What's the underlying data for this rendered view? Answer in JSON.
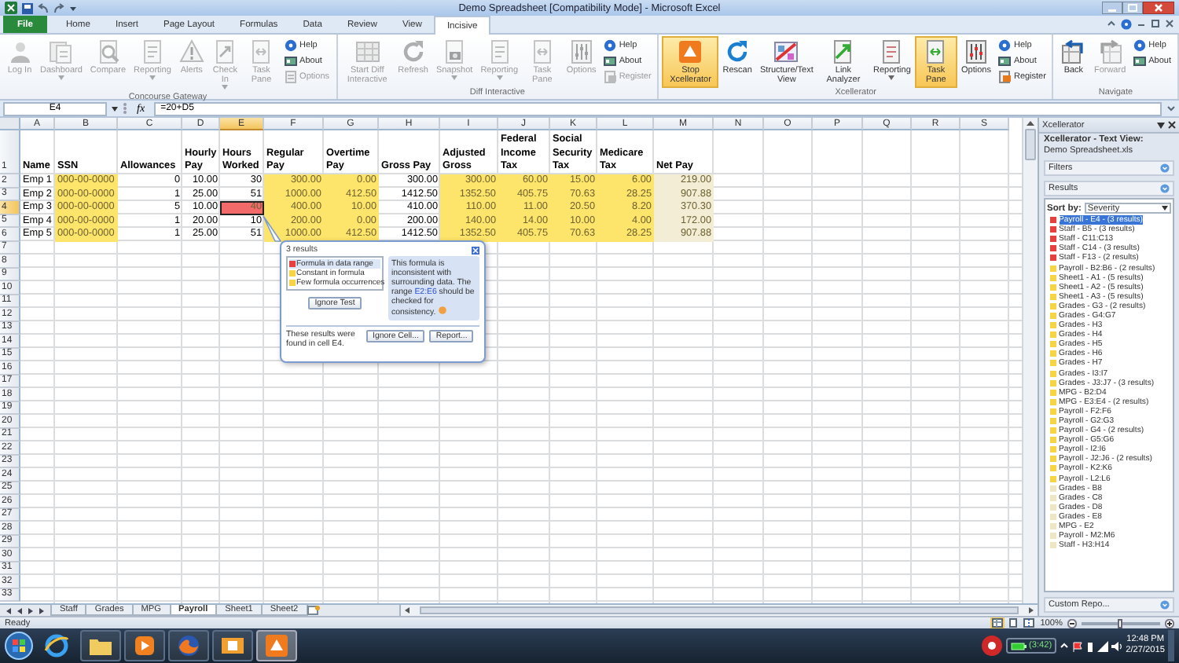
{
  "window": {
    "title": "Demo Spreadsheet  [Compatibility Mode] - Microsoft Excel"
  },
  "ribbon_tabs": [
    {
      "label": "File",
      "kind": "file",
      "selected": false
    },
    {
      "label": "Home",
      "kind": "plain",
      "selected": false
    },
    {
      "label": "Insert",
      "kind": "plain",
      "selected": false
    },
    {
      "label": "Page Layout",
      "kind": "plain",
      "selected": false
    },
    {
      "label": "Formulas",
      "kind": "plain",
      "selected": false
    },
    {
      "label": "Data",
      "kind": "plain",
      "selected": false
    },
    {
      "label": "Review",
      "kind": "plain",
      "selected": false
    },
    {
      "label": "View",
      "kind": "plain",
      "selected": false
    },
    {
      "label": "Incisive",
      "kind": "plain",
      "selected": true
    }
  ],
  "ribbon_groups": [
    {
      "name": "Concourse Gateway",
      "buttons": [
        {
          "label": "Log In",
          "kind": "person",
          "disabled": true,
          "selected": false
        },
        {
          "label": "Dashboard",
          "kind": "dashboard",
          "disabled": true,
          "selected": false,
          "has_menu": true
        },
        {
          "label": "Compare",
          "kind": "compare",
          "disabled": true,
          "selected": false
        },
        {
          "label": "Reporting",
          "kind": "report",
          "disabled": true,
          "selected": false,
          "has_menu": true
        },
        {
          "label": "Alerts",
          "kind": "warning",
          "disabled": true,
          "selected": false
        },
        {
          "label": "Check In",
          "kind": "checkin",
          "disabled": true,
          "selected": false,
          "has_menu": true
        },
        {
          "label": "Task Pane",
          "kind": "taskpane",
          "disabled": true,
          "selected": false
        }
      ],
      "small_buttons": [
        {
          "label": "Help",
          "kind": "help",
          "disabled": false
        },
        {
          "label": "About",
          "kind": "about",
          "disabled": false
        },
        {
          "label": "Options",
          "kind": "options",
          "disabled": true
        }
      ]
    },
    {
      "name": "Diff Interactive",
      "buttons": [
        {
          "label": "Start Diff Interactive",
          "kind": "grid",
          "disabled": true,
          "selected": false
        },
        {
          "label": "Refresh",
          "kind": "refresh",
          "disabled": true,
          "selected": false
        },
        {
          "label": "Snapshot",
          "kind": "camera",
          "disabled": true,
          "selected": false,
          "has_menu": true
        },
        {
          "label": "Reporting",
          "kind": "report",
          "disabled": true,
          "selected": false,
          "has_menu": true
        },
        {
          "label": "Task Pane",
          "kind": "taskpane",
          "disabled": true,
          "selected": false
        },
        {
          "label": "Options",
          "kind": "sliders",
          "disabled": true,
          "selected": false
        }
      ],
      "small_buttons": [
        {
          "label": "Help",
          "kind": "help",
          "disabled": false
        },
        {
          "label": "About",
          "kind": "about",
          "disabled": false
        },
        {
          "label": "Register",
          "kind": "register",
          "disabled": true
        }
      ]
    },
    {
      "name": "Xcellerator",
      "buttons": [
        {
          "label": "Stop Xcellerator",
          "kind": "logo",
          "disabled": false,
          "selected": true
        },
        {
          "label": "Rescan",
          "kind": "refresh",
          "disabled": false,
          "selected": false
        },
        {
          "label": "Structure/Text View",
          "kind": "structure",
          "disabled": false,
          "selected": false
        },
        {
          "label": "Link Analyzer",
          "kind": "link",
          "disabled": false,
          "selected": false
        },
        {
          "label": "Reporting",
          "kind": "report",
          "disabled": false,
          "selected": false,
          "has_menu": true
        },
        {
          "label": "Task Pane",
          "kind": "taskpane",
          "disabled": false,
          "selected": true
        },
        {
          "label": "Options",
          "kind": "sliders",
          "disabled": false,
          "selected": false
        }
      ],
      "small_buttons": [
        {
          "label": "Help",
          "kind": "help",
          "disabled": false
        },
        {
          "label": "About",
          "kind": "about",
          "disabled": false
        },
        {
          "label": "Register",
          "kind": "register",
          "disabled": false
        }
      ]
    },
    {
      "name": "Navigate",
      "buttons": [
        {
          "label": "Back",
          "kind": "back",
          "disabled": false,
          "selected": false
        },
        {
          "label": "Forward",
          "kind": "forward",
          "disabled": true,
          "selected": false
        }
      ],
      "small_buttons": [
        {
          "label": "Help",
          "kind": "help",
          "disabled": false
        },
        {
          "label": "About",
          "kind": "about",
          "disabled": false
        }
      ]
    }
  ],
  "formula_bar": {
    "name_box": "E4",
    "function_label": "fx",
    "formula": "=20+D5"
  },
  "sheet": {
    "columns": [
      {
        "letter": "A",
        "kind": "text",
        "selected": false
      },
      {
        "letter": "B",
        "kind": "text",
        "selected": false
      },
      {
        "letter": "C",
        "kind": "number",
        "selected": false
      },
      {
        "letter": "D",
        "kind": "number",
        "selected": false
      },
      {
        "letter": "E",
        "kind": "number",
        "selected": true
      },
      {
        "letter": "F",
        "kind": "number",
        "selected": false
      },
      {
        "letter": "G",
        "kind": "number",
        "selected": false
      },
      {
        "letter": "H",
        "kind": "number",
        "selected": false
      },
      {
        "letter": "I",
        "kind": "number",
        "selected": false
      },
      {
        "letter": "J",
        "kind": "number",
        "selected": false
      },
      {
        "letter": "K",
        "kind": "number",
        "selected": false
      },
      {
        "letter": "L",
        "kind": "number",
        "selected": false
      },
      {
        "letter": "M",
        "kind": "number",
        "selected": false
      },
      {
        "letter": "N",
        "selected": false
      },
      {
        "letter": "O",
        "selected": false
      },
      {
        "letter": "P",
        "selected": false
      },
      {
        "letter": "Q",
        "selected": false
      },
      {
        "letter": "R",
        "selected": false
      },
      {
        "letter": "S",
        "selected": false
      }
    ],
    "rows": [
      {
        "number": "1",
        "selected": false,
        "cells": [
          {
            "text": "Name"
          },
          {
            "text": "SSN"
          },
          {
            "text": "Allowances"
          },
          {
            "text": "Hourly Pay"
          },
          {
            "text": "Hours Worked"
          },
          {
            "text": "Regular Pay"
          },
          {
            "text": "Overtime Pay"
          },
          {
            "text": "Gross Pay"
          },
          {
            "text": "Adjusted Gross"
          },
          {
            "text": "Federal Income Tax"
          },
          {
            "text": "Social Security Tax"
          },
          {
            "text": "Medicare Tax"
          },
          {
            "text": "Net Pay"
          }
        ]
      },
      {
        "number": "2",
        "selected": false,
        "cells": [
          {
            "text": "Emp 1"
          },
          {
            "text": "000-00-0000",
            "color": "#fde46a"
          },
          {
            "text": "0"
          },
          {
            "text": "10.00"
          },
          {
            "text": "30"
          },
          {
            "text": "300.00",
            "color": "#fde46a"
          },
          {
            "text": "0.00",
            "color": "#fde46a"
          },
          {
            "text": "300.00"
          },
          {
            "text": "300.00",
            "color": "#fde46a"
          },
          {
            "text": "60.00",
            "color": "#fde46a"
          },
          {
            "text": "15.00",
            "color": "#fde46a"
          },
          {
            "text": "6.00",
            "color": "#fde46a"
          },
          {
            "text": "219.00",
            "color": "#f3edd6"
          }
        ]
      },
      {
        "number": "3",
        "selected": false,
        "cells": [
          {
            "text": "Emp 2"
          },
          {
            "text": "000-00-0000",
            "color": "#fde46a"
          },
          {
            "text": "1"
          },
          {
            "text": "25.00"
          },
          {
            "text": "51"
          },
          {
            "text": "1000.00",
            "color": "#fde46a"
          },
          {
            "text": "412.50",
            "color": "#fde46a"
          },
          {
            "text": "1412.50"
          },
          {
            "text": "1352.50",
            "color": "#fde46a"
          },
          {
            "text": "405.75",
            "color": "#fde46a"
          },
          {
            "text": "70.63",
            "color": "#fde46a"
          },
          {
            "text": "28.25",
            "color": "#fde46a"
          },
          {
            "text": "907.88",
            "color": "#f3edd6"
          }
        ]
      },
      {
        "number": "4",
        "selected": true,
        "cells": [
          {
            "text": "Emp 3"
          },
          {
            "text": "000-00-0000",
            "color": "#fde46a"
          },
          {
            "text": "5"
          },
          {
            "text": "10.00"
          },
          {
            "text": "40",
            "color": "#f26a6a"
          },
          {
            "text": "400.00",
            "color": "#fde46a"
          },
          {
            "text": "10.00",
            "color": "#fde46a"
          },
          {
            "text": "410.00"
          },
          {
            "text": "110.00",
            "color": "#fde46a"
          },
          {
            "text": "11.00",
            "color": "#fde46a"
          },
          {
            "text": "20.50",
            "color": "#fde46a"
          },
          {
            "text": "8.20",
            "color": "#fde46a"
          },
          {
            "text": "370.30",
            "color": "#f3edd6"
          }
        ]
      },
      {
        "number": "5",
        "selected": false,
        "cells": [
          {
            "text": "Emp 4"
          },
          {
            "text": "000-00-0000",
            "color": "#fde46a"
          },
          {
            "text": "1"
          },
          {
            "text": "20.00"
          },
          {
            "text": "10"
          },
          {
            "text": "200.00",
            "color": "#fde46a"
          },
          {
            "text": "0.00",
            "color": "#fde46a"
          },
          {
            "text": "200.00"
          },
          {
            "text": "140.00",
            "color": "#fde46a"
          },
          {
            "text": "14.00",
            "color": "#fde46a"
          },
          {
            "text": "10.00",
            "color": "#fde46a"
          },
          {
            "text": "4.00",
            "color": "#fde46a"
          },
          {
            "text": "172.00",
            "color": "#f3edd6"
          }
        ]
      },
      {
        "number": "6",
        "selected": false,
        "cells": [
          {
            "text": "Emp 5"
          },
          {
            "text": "000-00-0000",
            "color": "#fde46a"
          },
          {
            "text": "1"
          },
          {
            "text": "25.00"
          },
          {
            "text": "51"
          },
          {
            "text": "1000.00",
            "color": "#fde46a"
          },
          {
            "text": "412.50",
            "color": "#fde46a"
          },
          {
            "text": "1412.50"
          },
          {
            "text": "1352.50",
            "color": "#fde46a"
          },
          {
            "text": "405.75",
            "color": "#fde46a"
          },
          {
            "text": "70.63",
            "color": "#fde46a"
          },
          {
            "text": "28.25",
            "color": "#fde46a"
          },
          {
            "text": "907.88",
            "color": "#f3edd6"
          }
        ]
      },
      {
        "number": "7",
        "selected": false
      },
      {
        "number": "8",
        "selected": false
      },
      {
        "number": "9",
        "selected": false
      },
      {
        "number": "10",
        "selected": false
      },
      {
        "number": "11",
        "selected": false
      },
      {
        "number": "12",
        "selected": false
      },
      {
        "number": "13",
        "selected": false
      },
      {
        "number": "14",
        "selected": false
      },
      {
        "number": "15",
        "selected": false
      },
      {
        "number": "16",
        "selected": false
      },
      {
        "number": "17",
        "selected": false
      },
      {
        "number": "18",
        "selected": false
      },
      {
        "number": "19",
        "selected": false
      },
      {
        "number": "20",
        "selected": false
      },
      {
        "number": "21",
        "selected": false
      },
      {
        "number": "22",
        "selected": false
      },
      {
        "number": "23",
        "selected": false
      },
      {
        "number": "24",
        "selected": false
      },
      {
        "number": "25",
        "selected": false
      },
      {
        "number": "26",
        "selected": false
      },
      {
        "number": "27",
        "selected": false
      },
      {
        "number": "28",
        "selected": false
      },
      {
        "number": "29",
        "selected": false
      },
      {
        "number": "30",
        "selected": false
      },
      {
        "number": "31",
        "selected": false
      },
      {
        "number": "32",
        "selected": false
      },
      {
        "number": "33",
        "selected": false
      }
    ]
  },
  "popup": {
    "title": "3 results",
    "results": [
      {
        "label": "Formula in data range",
        "color": "#e8403c",
        "selected": true
      },
      {
        "label": "Constant in formula",
        "color": "#f7d443",
        "selected": false
      },
      {
        "label": "Few formula occurrences",
        "color": "#f7d443",
        "selected": false
      }
    ],
    "ignore_button": "Ignore Test",
    "message_before": "This formula is inconsistent with surrounding data. The range ",
    "message_link": "E2:E6",
    "message_after": " should be checked for consistency.",
    "footer_text": "These results were found in cell E4.",
    "buttons": [
      "Ignore Cell...",
      "Report..."
    ]
  },
  "sheet_tabs": [
    {
      "label": "Staff",
      "selected": false
    },
    {
      "label": "Grades",
      "selected": false
    },
    {
      "label": "MPG",
      "selected": false
    },
    {
      "label": "Payroll",
      "selected": true
    },
    {
      "label": "Sheet1",
      "selected": false
    },
    {
      "label": "Sheet2",
      "selected": false
    }
  ],
  "task_pane": {
    "title": "Xcellerator",
    "heading": "Xcellerator - Text View:",
    "file": "Demo Spreadsheet.xls",
    "sections": [
      "Filters",
      "Results"
    ],
    "sort_label": "Sort by:",
    "sort_value": "Severity",
    "results": [
      {
        "label": "Payroll - E4 - (3 results)",
        "color": "#e8403c",
        "selected": true
      },
      {
        "label": "Staff - B5 - (3 results)",
        "color": "#e8403c",
        "selected": false
      },
      {
        "label": "Staff - C11:C13",
        "color": "#e8403c",
        "selected": false
      },
      {
        "label": "Staff - C14 - (3 results)",
        "color": "#e8403c",
        "selected": false
      },
      {
        "label": "Staff - F13 - (2 results)",
        "color": "#e8403c",
        "selected": false
      },
      {
        "label": "Payroll - B2:B6 - (2 results)",
        "color": "#f7d443",
        "selected": false
      },
      {
        "label": "Sheet1 - A1 - (5 results)",
        "color": "#f7d443",
        "selected": false
      },
      {
        "label": "Sheet1 - A2 - (5 results)",
        "color": "#f7d443",
        "selected": false
      },
      {
        "label": "Sheet1 - A3 - (5 results)",
        "color": "#f7d443",
        "selected": false
      },
      {
        "label": "Grades - G3 - (2 results)",
        "color": "#f7d443",
        "selected": false
      },
      {
        "label": "Grades - G4:G7",
        "color": "#f7d443",
        "selected": false
      },
      {
        "label": "Grades - H3",
        "color": "#f7d443",
        "selected": false
      },
      {
        "label": "Grades - H4",
        "color": "#f7d443",
        "selected": false
      },
      {
        "label": "Grades - H5",
        "color": "#f7d443",
        "selected": false
      },
      {
        "label": "Grades - H6",
        "color": "#f7d443",
        "selected": false
      },
      {
        "label": "Grades - H7",
        "color": "#f7d443",
        "selected": false
      },
      {
        "label": "Grades - I3:I7",
        "color": "#f7d443",
        "selected": false
      },
      {
        "label": "Grades - J3:J7 - (3 results)",
        "color": "#f7d443",
        "selected": false
      },
      {
        "label": "MPG - B2:D4",
        "color": "#f7d443",
        "selected": false
      },
      {
        "label": "MPG - E3:E4 - (2 results)",
        "color": "#f7d443",
        "selected": false
      },
      {
        "label": "Payroll - F2:F6",
        "color": "#f7d443",
        "selected": false
      },
      {
        "label": "Payroll - G2:G3",
        "color": "#f7d443",
        "selected": false
      },
      {
        "label": "Payroll - G4 - (2 results)",
        "color": "#f7d443",
        "selected": false
      },
      {
        "label": "Payroll - G5:G6",
        "color": "#f7d443",
        "selected": false
      },
      {
        "label": "Payroll - I2:I6",
        "color": "#f7d443",
        "selected": false
      },
      {
        "label": "Payroll - J2:J6 - (2 results)",
        "color": "#f7d443",
        "selected": false
      },
      {
        "label": "Payroll - K2:K6",
        "color": "#f7d443",
        "selected": false
      },
      {
        "label": "Payroll - L2:L6",
        "color": "#f7d443",
        "selected": false
      },
      {
        "label": "Grades - B8",
        "color": "#efe6c4",
        "selected": false
      },
      {
        "label": "Grades - C8",
        "color": "#efe6c4",
        "selected": false
      },
      {
        "label": "Grades - D8",
        "color": "#efe6c4",
        "selected": false
      },
      {
        "label": "Grades - E8",
        "color": "#efe6c4",
        "selected": false
      },
      {
        "label": "MPG - E2",
        "color": "#efe6c4",
        "selected": false
      },
      {
        "label": "Payroll - M2:M6",
        "color": "#efe6c4",
        "selected": false
      },
      {
        "label": "Staff - H3:H14",
        "color": "#efe6c4",
        "selected": false
      }
    ],
    "footer": "Custom Repo..."
  },
  "status_bar": {
    "text": "Ready",
    "view_buttons": [
      {
        "kind": "normal",
        "selected": true
      },
      {
        "kind": "layout",
        "selected": false
      },
      {
        "kind": "pagebreak",
        "selected": false
      }
    ],
    "zoom": "100%",
    "zoom_slider": {
      "level": 0.5
    }
  },
  "taskbar": {
    "apps": [
      {
        "kind": "ie",
        "running": false,
        "selected": false
      },
      {
        "kind": "folder",
        "running": true,
        "selected": false
      },
      {
        "kind": "media",
        "running": true,
        "selected": false
      },
      {
        "kind": "firefox",
        "running": true,
        "selected": false
      },
      {
        "kind": "mail",
        "running": true,
        "selected": false
      },
      {
        "kind": "logo",
        "running": true,
        "selected": true
      }
    ],
    "battery": "(3:42)",
    "time": "12:48 PM",
    "date": "2/27/2015"
  }
}
